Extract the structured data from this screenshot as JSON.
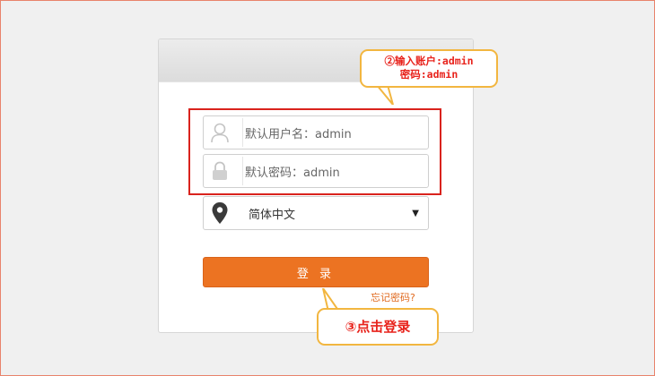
{
  "form": {
    "username_placeholder": "默认用户名：admin",
    "password_placeholder": "默认密码：admin",
    "language": "简体中文",
    "login_label": "登 录",
    "forgot_label": "忘记密码?"
  },
  "annotations": {
    "step2_line1": "②输入账户:admin",
    "step2_line2": "密码:admin",
    "step3": "③点击登录"
  },
  "colors": {
    "accent": "#ec7322",
    "highlight": "#d9231d",
    "callout_border": "#f2b640",
    "callout_text": "#e8231c"
  },
  "icons": {
    "username": "user-icon",
    "password": "lock-icon",
    "language": "location-pin-icon",
    "dropdown": "caret-down-icon"
  }
}
